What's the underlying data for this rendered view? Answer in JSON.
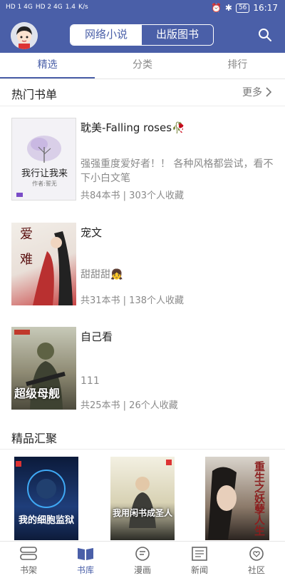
{
  "status": {
    "network_left": "HD 1 4G",
    "network_right": "HD 2 4G",
    "speed": "1.4",
    "speed_unit": "K/s",
    "battery": "56",
    "time": "16:17"
  },
  "header": {
    "seg_left": "网络小说",
    "seg_right": "出版图书"
  },
  "tabs": [
    "精选",
    "分类",
    "排行"
  ],
  "hot": {
    "title": "热门书单",
    "more": "更多"
  },
  "booklists": [
    {
      "title": "耽美-Falling roses🥀",
      "desc": "强强重度爱好者！！ 各种风格都尝试，看不下小白文笔",
      "meta": "共84本书 | 303个人收藏",
      "cover_title": "我行让我来",
      "cover_author": "作者:誓无"
    },
    {
      "title": "宠文",
      "desc": "甜甜甜👧",
      "meta": "共31本书 | 138个人收藏",
      "cover_title": "爱 难"
    },
    {
      "title": "自己看",
      "desc": "111",
      "meta": "共25本书 | 26个人收藏",
      "cover_title": "超级母舰"
    }
  ],
  "featured": {
    "title": "精品汇聚",
    "books": [
      "我的细胞监狱",
      "我用闲书成圣人",
      "重生之妖孽人生"
    ]
  },
  "bottom_nav": [
    "书架",
    "书库",
    "漫画",
    "新闻",
    "社区"
  ]
}
